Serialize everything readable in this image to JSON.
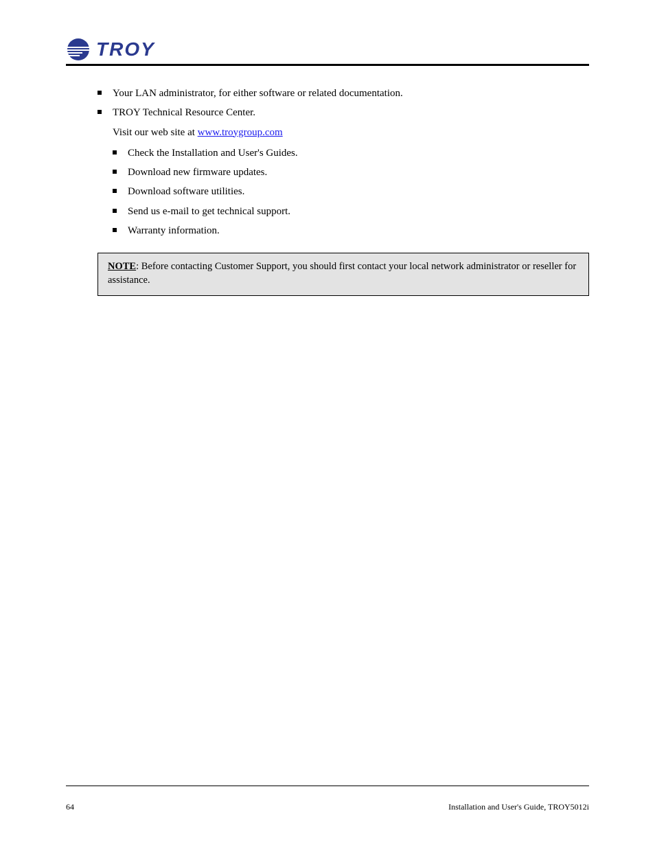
{
  "logo": {
    "text": "TROY"
  },
  "bullets_a": [
    "Your LAN administrator, for either software or related documentation.",
    "TROY Technical Resource Center."
  ],
  "link": {
    "text": "www.troygroup.com",
    "href": "www.troygroup.com"
  },
  "sublist_intro": "Visit our web site at",
  "bullets_b": [
    "Check the Installation and User's Guides.",
    "Download new firmware updates.",
    "Download software utilities.",
    "Send us e-mail to get technical support.",
    "Warranty information."
  ],
  "note": {
    "label": "NOTE",
    "text": "Before contacting Customer Support, you should first contact your local network administrator or reseller for assistance."
  },
  "footer": {
    "left": "64",
    "right": "Installation and User's Guide, TROY5012i"
  }
}
